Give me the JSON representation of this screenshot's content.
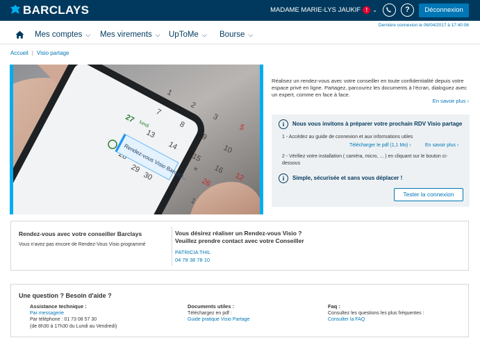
{
  "header": {
    "brand": "BARCLAYS",
    "user_name": "MADAME MARIE-LYS JAUKIF",
    "alert_badge": "!",
    "logout_label": "Déconnexion",
    "help_glyph": "?",
    "last_connection": "Dernière connexion le 06/04/2017 à 17:40:06",
    "brand_color": "#00395d",
    "accent_color": "#0076b6"
  },
  "nav": {
    "items": [
      {
        "label": "Mes comptes"
      },
      {
        "label": "Mes virements"
      },
      {
        "label": "UpToMe"
      },
      {
        "label": "Bourse"
      }
    ]
  },
  "breadcrumb": {
    "home": "Accueil",
    "current": "Visio partage"
  },
  "hero": {
    "calendar_dates": [
      "27",
      "28",
      "29",
      "30",
      "26",
      "19",
      "12",
      "5"
    ],
    "calendar_day": "lundi",
    "overlay_text": "Rendez-vous Visio Barclay..."
  },
  "intro": {
    "text": "Réalisez un rendez-vous avec votre conseiller en toute confidentialité depuis votre espace privé en ligne. Partagez, parcourez les documents à l'écran, dialoguez avec un expert, comme en face à face.",
    "more": "En savoir plus"
  },
  "prepare": {
    "title": "Nous vous invitons à préparer votre prochain RDV Visio partage",
    "step1": "1 - Accédez au guide de connexion et aux informations utiles",
    "download": "Télécharger le pdf (1,1 Mo)",
    "more": "En savoir plus",
    "step2": "2 - Vérifiez votre installation ( caméra, micro, ... ) en cliquant sur le bouton ci-dessous",
    "simple": "Simple, sécurisée et sans vous déplacer !",
    "test_button": "Tester la connexion"
  },
  "rdv": {
    "title": "Rendez-vous avec votre conseiller Barclays",
    "none": "Vous n'avez pas encore de Rendez-Vous Visio programmé",
    "question_line1": "Vous désirez réaliser un Rendez-vous Visio ?",
    "question_line2": "Veuillez prendre contact avec votre Conseiller",
    "advisor_name": "PATRICIA THIL",
    "advisor_phone": "04 78 38 78 10"
  },
  "help": {
    "title": "Une question ? Besoin d'aide ?",
    "assistance": {
      "title": "Assistance technique :",
      "link": "Par messagerie",
      "phone": "Par téléphone : 01 73 08 57 30",
      "hours": "(de 8h30 à 17h30 du Lundi au Vendredi)"
    },
    "documents": {
      "title": "Documents utiles :",
      "text": "Téléchargez en pdf :",
      "link": "Guide pratique Visio Partage"
    },
    "faq": {
      "title": "Faq :",
      "text": "Consultez les questions les plus fréquentes :",
      "link": "Consulter la FAQ"
    }
  }
}
